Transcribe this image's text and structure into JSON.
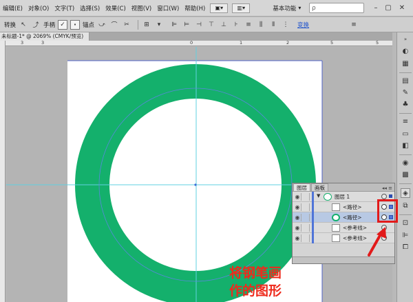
{
  "menubar": {
    "items": [
      "编辑(E)",
      "对象(O)",
      "文字(T)",
      "选择(S)",
      "效果(C)",
      "视图(V)",
      "窗口(W)",
      "帮助(H)"
    ],
    "workspace": "基本功能",
    "search_icon_glyph": "ρ"
  },
  "controlbar": {
    "convert_label": "转换",
    "handle_label": "手柄",
    "anchor_label": "锚点",
    "link_label": "变换"
  },
  "document": {
    "tab_title": "未标题-1* @ 2069% (CMYK/预览)"
  },
  "ruler": {
    "numbers": [
      "3",
      "3",
      "0",
      "1",
      "2",
      "5",
      "5"
    ]
  },
  "layers_panel": {
    "tabs": [
      "图层",
      "画板"
    ],
    "rows": [
      {
        "name": "图层 1",
        "type": "layer",
        "selected": false
      },
      {
        "name": "<路径>",
        "type": "path",
        "selected": false
      },
      {
        "name": "<路径>",
        "type": "path",
        "selected": true
      },
      {
        "name": "<参考线>",
        "type": "guide",
        "selected": false
      },
      {
        "name": "<参考线>",
        "type": "guide",
        "selected": false
      }
    ]
  },
  "artwork": {
    "ring_color": "#14b06c",
    "guide_color": "#5fd0e0",
    "artboard_border": "#4f63c7"
  },
  "annotation": {
    "caption_line1": "将钢笔画",
    "caption_line2": "作的图形"
  }
}
